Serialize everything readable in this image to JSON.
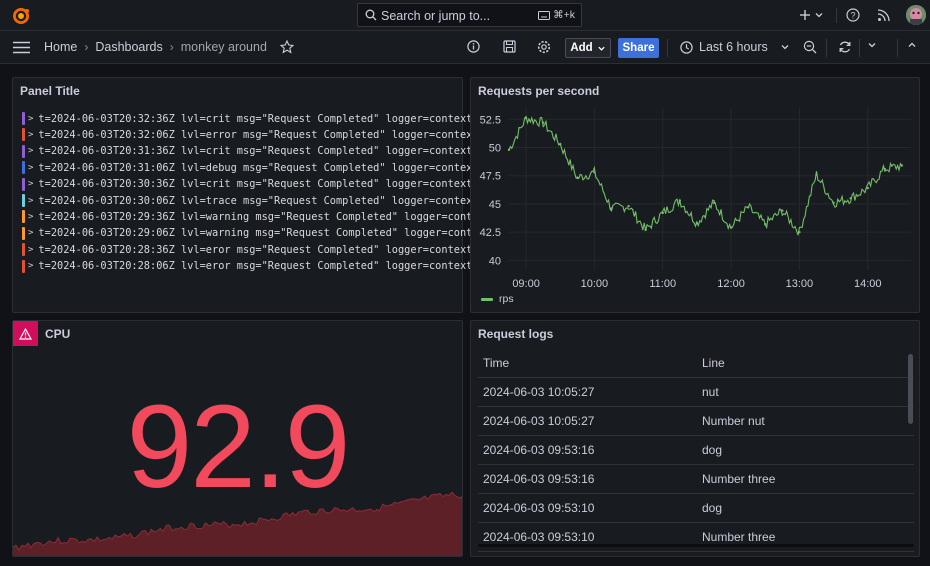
{
  "topbar": {
    "search_placeholder": "Search or jump to...",
    "search_shortcut": "⌘+k"
  },
  "navbar": {
    "breadcrumb": [
      "Home",
      "Dashboards",
      "monkey around"
    ],
    "add_label": "Add",
    "share_label": "Share",
    "time_range": "Last 6 hours"
  },
  "panels": {
    "logs_panel": {
      "title": "Panel Title",
      "rows": [
        {
          "level_color": "#8f5fd4",
          "text": "t=2024-06-03T20:32:36Z lvl=crit msg=\"Request Completed\" logger=context"
        },
        {
          "level_color": "#e0532f",
          "text": "t=2024-06-03T20:32:06Z lvl=error msg=\"Request Completed\" logger=context"
        },
        {
          "level_color": "#8f5fd4",
          "text": "t=2024-06-03T20:31:36Z lvl=crit msg=\"Request Completed\" logger=context"
        },
        {
          "level_color": "#3d71d9",
          "text": "t=2024-06-03T20:31:06Z lvl=debug msg=\"Request Completed\" logger=context"
        },
        {
          "level_color": "#8f5fd4",
          "text": "t=2024-06-03T20:30:36Z lvl=crit msg=\"Request Completed\" logger=context"
        },
        {
          "level_color": "#6ccfe0",
          "text": "t=2024-06-03T20:30:06Z lvl=trace msg=\"Request Completed\" logger=context"
        },
        {
          "level_color": "#ff9830",
          "text": "t=2024-06-03T20:29:36Z lvl=warning msg=\"Request Completed\" logger=conte"
        },
        {
          "level_color": "#ff9830",
          "text": "t=2024-06-03T20:29:06Z lvl=warning msg=\"Request Completed\" logger=conte"
        },
        {
          "level_color": "#e0532f",
          "text": "t=2024-06-03T20:28:36Z lvl=eror msg=\"Request Completed\" logger=context"
        },
        {
          "level_color": "#e0532f",
          "text": "t=2024-06-03T20:28:06Z lvl=eror msg=\"Request Completed\" logger=context"
        }
      ]
    },
    "rps_panel": {
      "title": "Requests per second",
      "legend": "rps",
      "y_ticks": [
        "52.5",
        "50",
        "47.5",
        "45",
        "42.5",
        "40"
      ],
      "x_ticks": [
        "09:00",
        "10:00",
        "11:00",
        "12:00",
        "13:00",
        "14:00"
      ],
      "series_color": "#73bf69"
    },
    "cpu_panel": {
      "title": "CPU",
      "value": "92.9",
      "value_color": "#f2495c"
    },
    "request_logs": {
      "title": "Request logs",
      "columns": [
        "Time",
        "Line"
      ],
      "rows": [
        [
          "2024-06-03 10:05:27",
          "nut"
        ],
        [
          "2024-06-03 10:05:27",
          "Number nut"
        ],
        [
          "2024-06-03 09:53:16",
          "dog"
        ],
        [
          "2024-06-03 09:53:16",
          "Number three"
        ],
        [
          "2024-06-03 09:53:10",
          "dog"
        ],
        [
          "2024-06-03 09:53:10",
          "Number three"
        ]
      ]
    }
  },
  "chart_data": {
    "type": "line",
    "x": [
      "08:45",
      "09:00",
      "09:15",
      "09:30",
      "09:45",
      "10:00",
      "10:15",
      "10:30",
      "10:45",
      "11:00",
      "11:15",
      "11:30",
      "11:45",
      "12:00",
      "12:15",
      "12:30",
      "12:45",
      "13:00",
      "13:15",
      "13:30",
      "13:45",
      "14:00",
      "14:15",
      "14:30"
    ],
    "series": [
      {
        "name": "rps",
        "values": [
          49.8,
          52.6,
          52.2,
          50.3,
          47.3,
          47.8,
          44.6,
          44.8,
          42.7,
          44.2,
          45.3,
          43.3,
          45.1,
          42.9,
          44.7,
          43.2,
          44.4,
          42.5,
          47.6,
          45.1,
          45.5,
          46.4,
          48.1,
          48.4
        ]
      }
    ],
    "y_ticks": [
      40,
      42.5,
      45,
      47.5,
      50,
      52.5
    ],
    "ylim": [
      39.5,
      53.5
    ],
    "grid": true,
    "legend_position": "bottom-left"
  }
}
